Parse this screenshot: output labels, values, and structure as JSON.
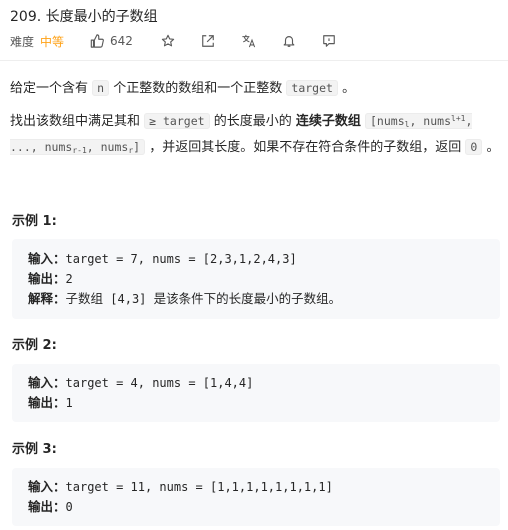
{
  "problem": {
    "title": "209. 长度最小的子数组",
    "difficulty_label": "难度",
    "difficulty": "中等",
    "likes": "642",
    "icons": [
      "thumbs-up-icon",
      "star-icon",
      "share-icon",
      "translate-icon",
      "bell-icon",
      "comment-icon"
    ]
  },
  "description": {
    "p1_a": "给定一个含有",
    "p1_n": "n",
    "p1_b": "个正整数的数组和一个正整数",
    "p1_target": "target",
    "p1_c": "。",
    "p2_a": "找出该数组中满足其和",
    "p2_ge": "≥ target",
    "p2_b": "的长度最小的",
    "p2_bold": "连续子数组",
    "p2_code1": "[nums",
    "p2_l": "l",
    "p2_code2": ", nums",
    "p2_l1": "l+1",
    "p2_code3": ", ..., nums",
    "p2_r1": "r-1",
    "p2_code4": ", nums",
    "p2_r": "r",
    "p2_code5": "]",
    "p2_c": "，并返回其长度。如果不存在符合条件的子数组，返回",
    "p2_zero": "0",
    "p2_end": "。"
  },
  "examples": [
    {
      "title": "示例 1:",
      "input_key": "输入：",
      "input": "target = 7, nums = [2,3,1,2,4,3]",
      "output_key": "输出：",
      "output": "2",
      "explain_key": "解释：",
      "explain_a": "子数组",
      "explain_code": "[4,3]",
      "explain_b": "是该条件下的长度最小的子数组。"
    },
    {
      "title": "示例 2:",
      "input_key": "输入：",
      "input": "target = 4, nums = [1,4,4]",
      "output_key": "输出：",
      "output": "1"
    },
    {
      "title": "示例 3:",
      "input_key": "输入：",
      "input": "target = 11, nums = [1,1,1,1,1,1,1,1]",
      "output_key": "输出：",
      "output": "0"
    }
  ],
  "colors": {
    "accent": "#ffa116",
    "code_bg": "#f7f8fa"
  }
}
